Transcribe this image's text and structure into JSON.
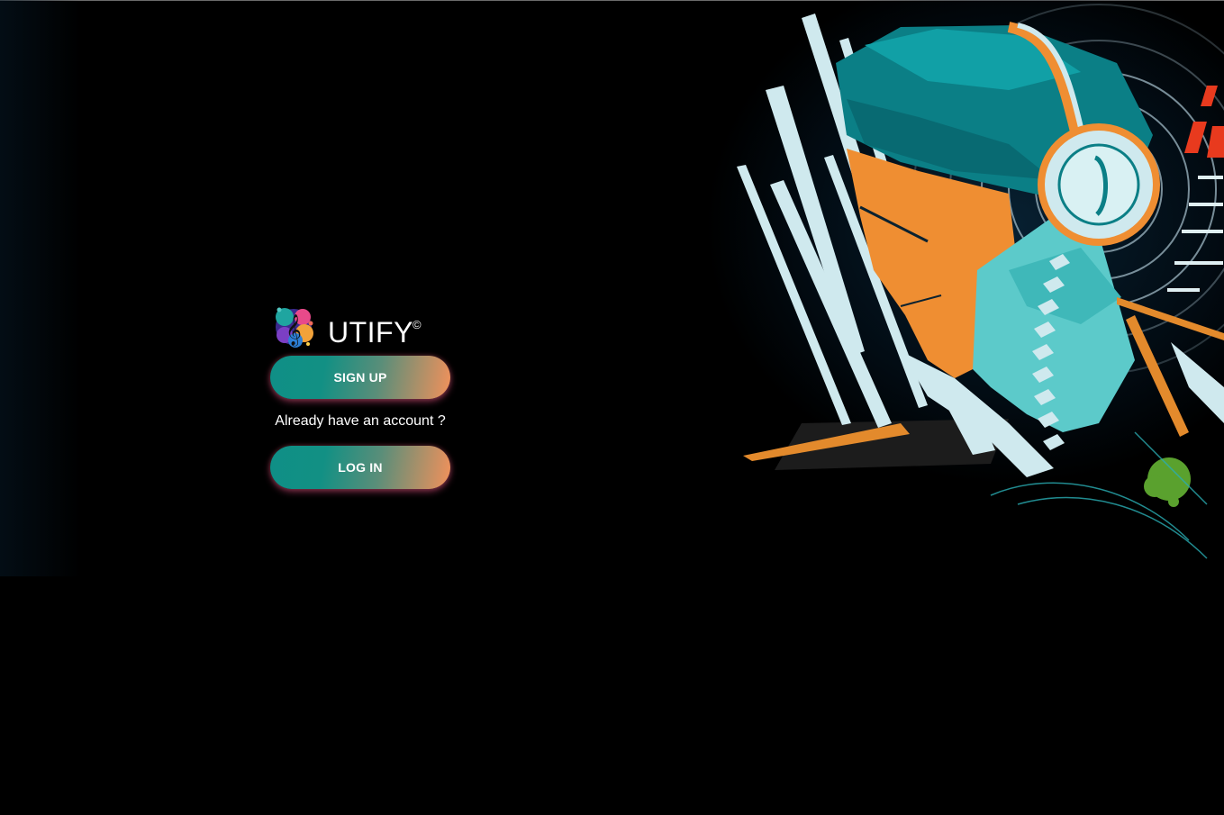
{
  "brand": {
    "name": "UTIFY",
    "mark": "©",
    "logo_icon": "treble-clef-icon"
  },
  "auth": {
    "signup_label": "SIGN UP",
    "prompt": "Already have an account ?",
    "login_label": "LOG IN"
  },
  "hero": {
    "icon": "headphones-listener-illustration"
  },
  "colors": {
    "background": "#000000",
    "button_start": "#0f8f86",
    "button_end": "#f2915b",
    "accent_teal": "#0b8d92",
    "accent_orange": "#f08b2c",
    "accent_ice": "#cdeaee",
    "accent_red": "#e83a1e"
  }
}
